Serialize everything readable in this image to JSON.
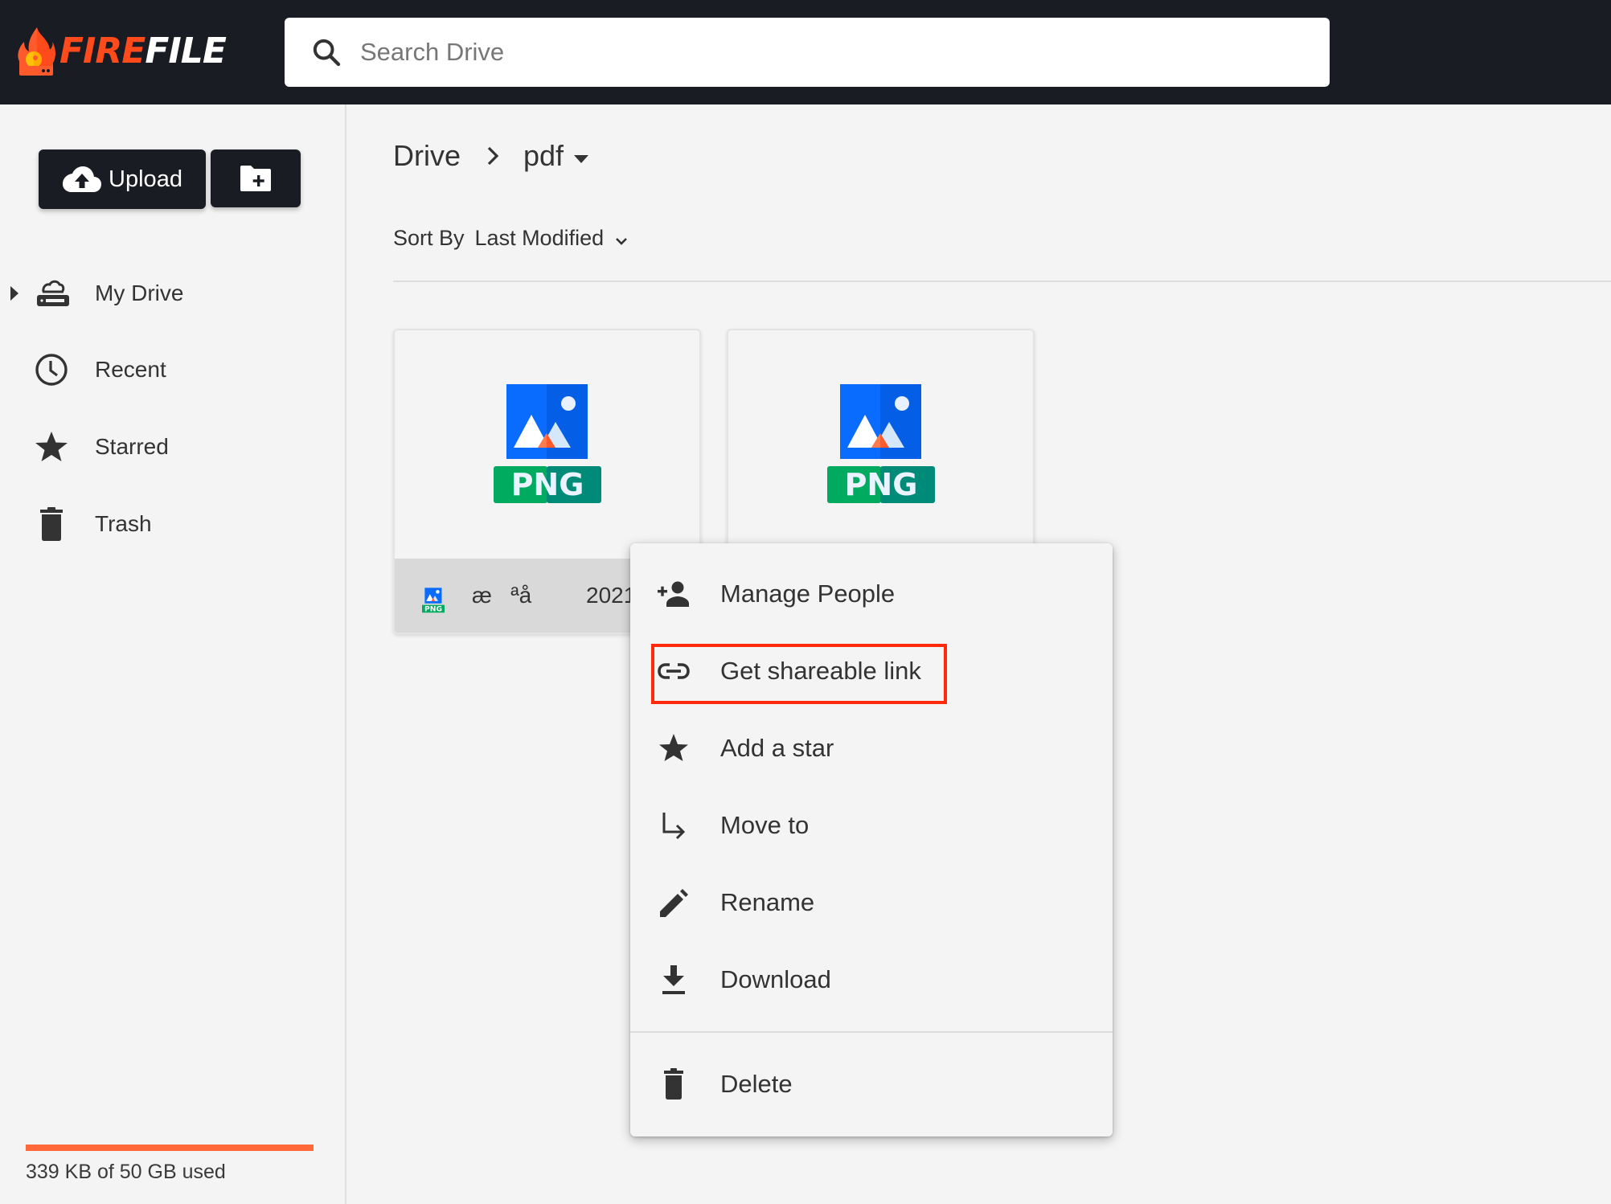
{
  "header": {
    "logo": {
      "part1": "FIRE",
      "part2": "FILE"
    },
    "search": {
      "placeholder": "Search Drive",
      "value": "",
      "icon": "search-icon"
    }
  },
  "sidebar": {
    "upload_label": "Upload",
    "new_folder_icon": "new-folder-icon",
    "nav": [
      {
        "label": "My Drive",
        "icon": "drive-icon",
        "expandable": true
      },
      {
        "label": "Recent",
        "icon": "clock-icon"
      },
      {
        "label": "Starred",
        "icon": "star-icon"
      },
      {
        "label": "Trash",
        "icon": "trash-icon"
      }
    ],
    "storage": {
      "text": "339 KB of 50 GB used",
      "used_fraction": 1.0,
      "bar_color": "#ff6838"
    }
  },
  "main": {
    "breadcrumb": {
      "root": "Drive",
      "current": "pdf"
    },
    "sort": {
      "label": "Sort By",
      "value": "Last Modified"
    },
    "files": [
      {
        "type": "PNG",
        "name": "æ   ªå",
        "date": "2021",
        "footer_visible": true
      },
      {
        "type": "PNG",
        "name": "",
        "date": "",
        "footer_visible": false
      }
    ]
  },
  "context_menu": {
    "items": [
      {
        "label": "Manage People",
        "icon": "person-add-icon"
      },
      {
        "label": "Get shareable link",
        "icon": "link-icon",
        "highlighted": true
      },
      {
        "label": "Add a star",
        "icon": "star-icon"
      },
      {
        "label": "Move to",
        "icon": "move-arrow-icon"
      },
      {
        "label": "Rename",
        "icon": "pencil-icon"
      },
      {
        "label": "Download",
        "icon": "download-icon"
      }
    ],
    "danger_items": [
      {
        "label": "Delete",
        "icon": "trash-icon"
      }
    ],
    "highlight_color": "#ff2a0c"
  },
  "colors": {
    "header_bg": "#191c23",
    "brand_orange": "#ff4a1c",
    "page_bg": "#f4f4f4",
    "text": "#333333"
  }
}
